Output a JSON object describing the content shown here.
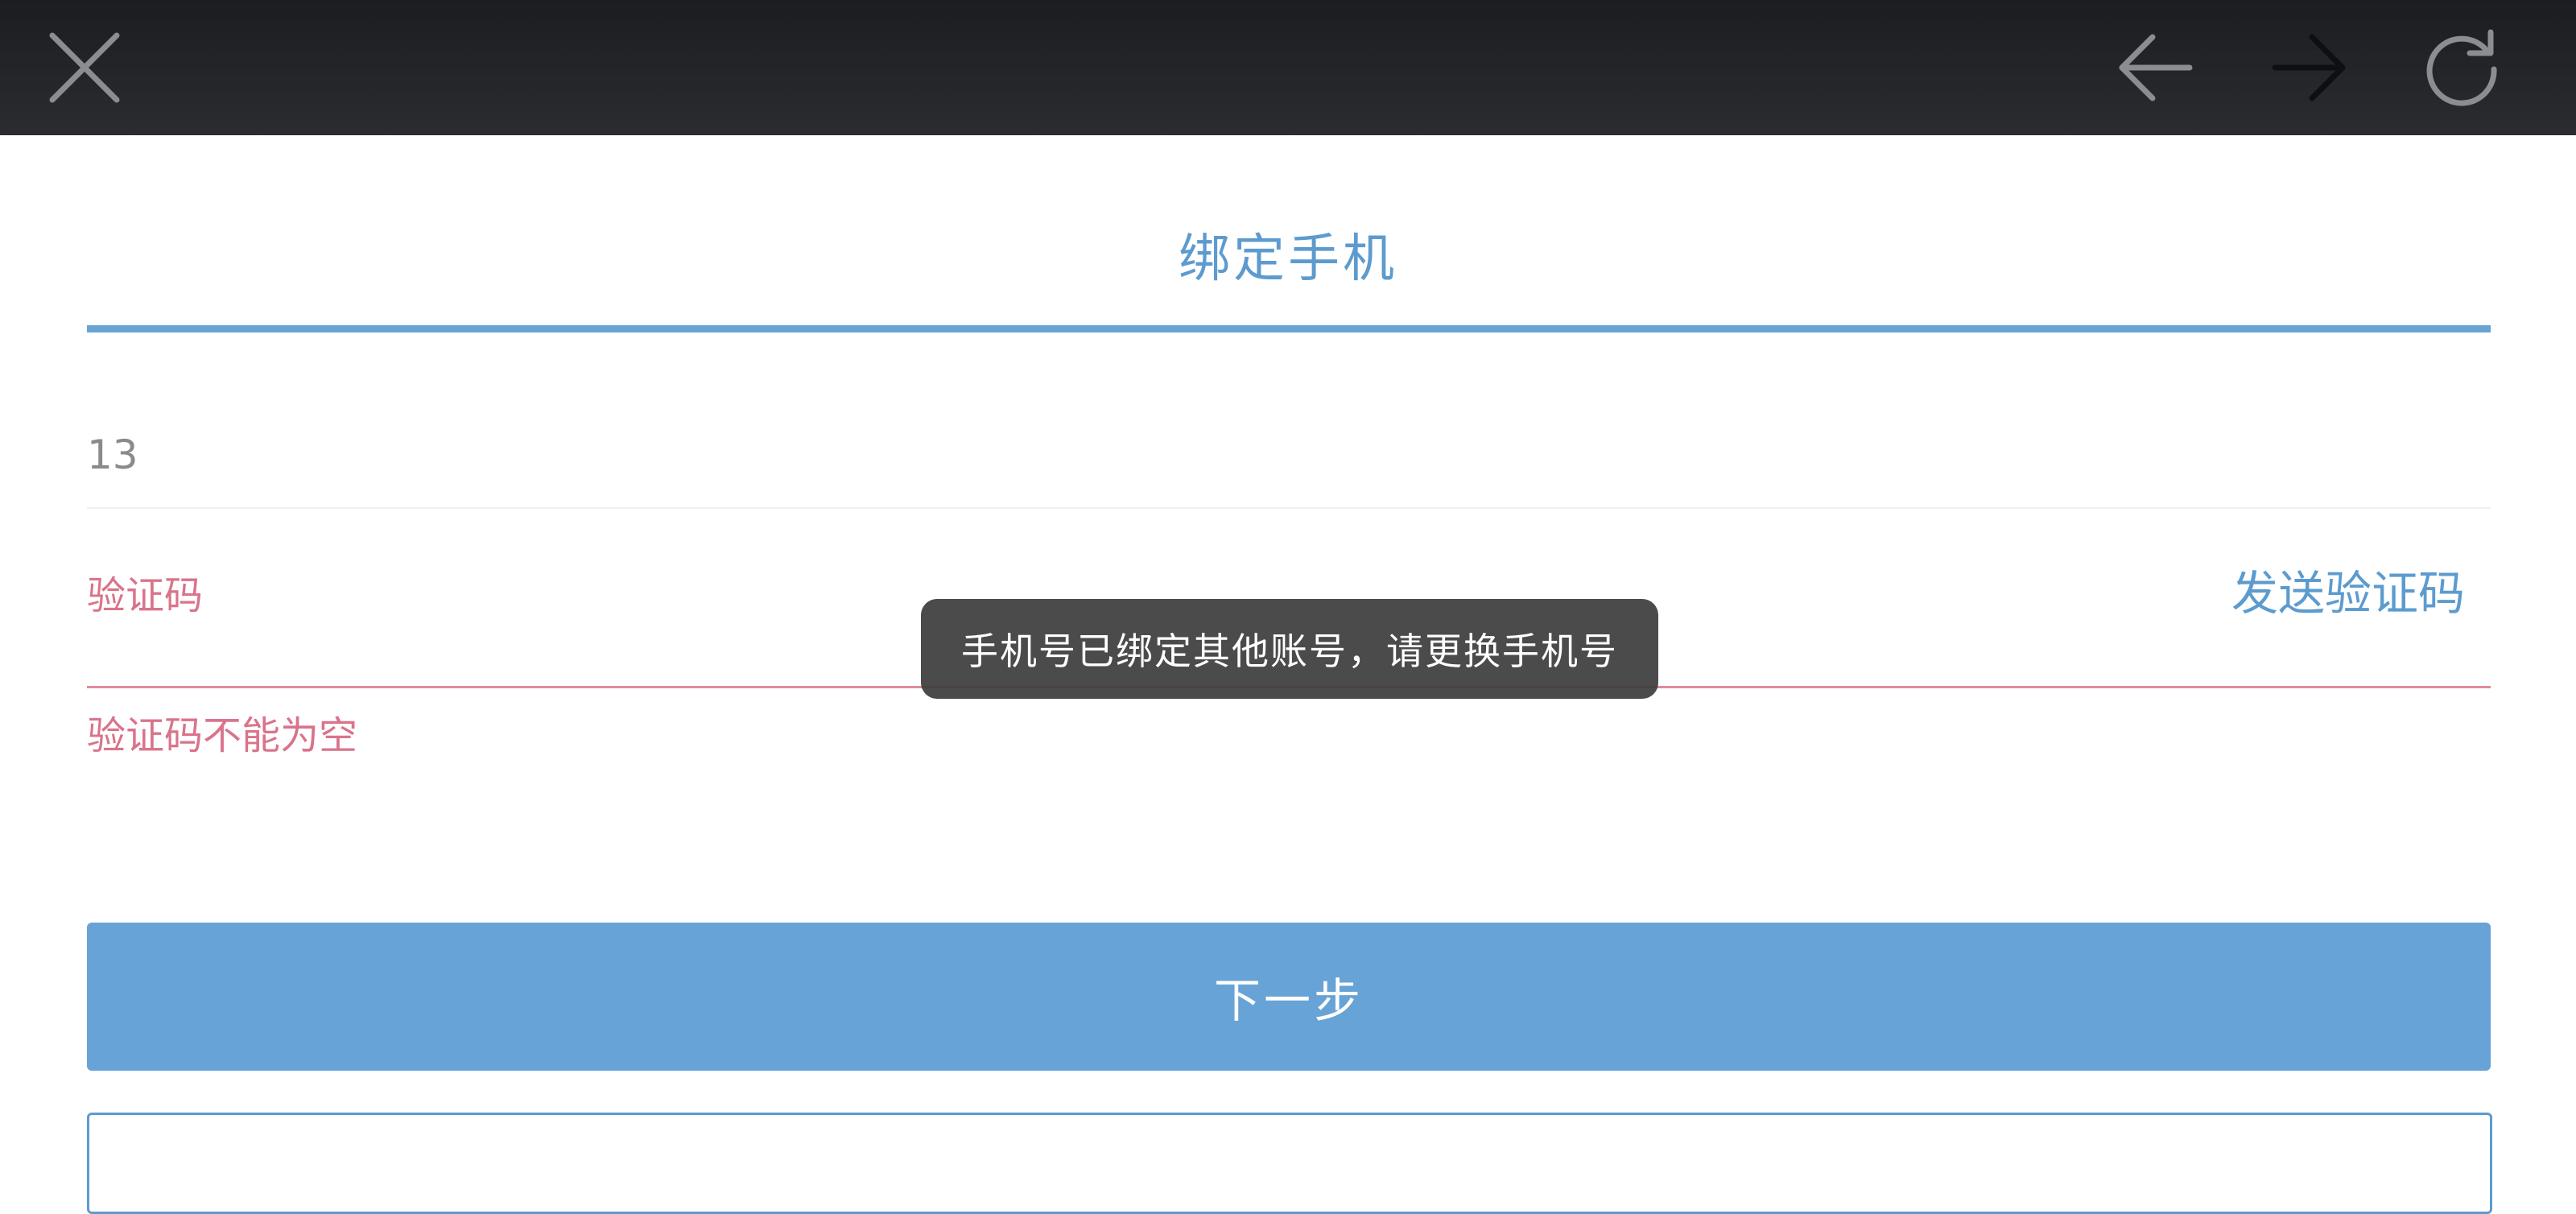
{
  "topbar": {
    "close_icon": "close-icon",
    "back_icon": "arrow-left-icon",
    "forward_icon": "arrow-right-icon",
    "reload_icon": "reload-icon"
  },
  "page": {
    "title": "绑定手机"
  },
  "form": {
    "phone_value": "13",
    "code_placeholder": "验证码",
    "send_code_label": "发送验证码",
    "code_error": "验证码不能为空",
    "next_label": "下一步"
  },
  "toast": {
    "message": "手机号已绑定其他账号，请更换手机号"
  },
  "colors": {
    "accent": "#5d9bcf",
    "error": "#d9748a",
    "topbar": "#222327"
  }
}
